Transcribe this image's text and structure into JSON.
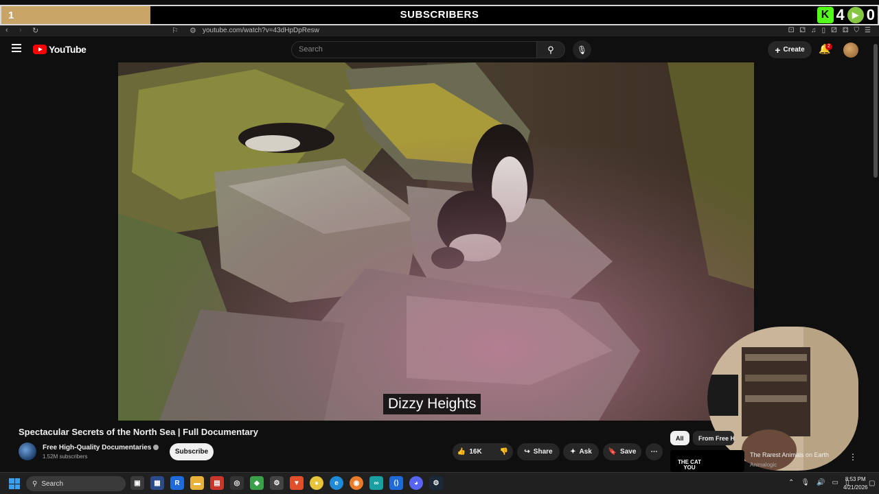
{
  "overlay": {
    "count": "1",
    "label": "SUBSCRIBERS",
    "progress": 0.17,
    "kick_count": "4",
    "rumble_count": "0"
  },
  "browser": {
    "url": "youtube.com/watch?v=43dHpDpResw"
  },
  "header": {
    "logo_text": "YouTube",
    "search_placeholder": "Search",
    "create_label": "Create",
    "notification_count": "2"
  },
  "player": {
    "subtitle": "Dizzy Heights"
  },
  "video": {
    "title": "Spectacular Secrets of the North Sea | Full Documentary",
    "channel_name": "Free High-Quality Documentaries",
    "channel_subs": "1.52M subscribers",
    "subscribe_label": "Subscribe",
    "likes": "16K",
    "share_label": "Share",
    "ask_label": "Ask",
    "save_label": "Save"
  },
  "sidebar": {
    "chips": [
      "All",
      "From Free H"
    ],
    "recommendation": {
      "thumb_text": "THE CAT YOU",
      "title": "The Rarest Animals on Earth",
      "channel": "Animalogic"
    }
  },
  "taskbar": {
    "search_label": "Search",
    "time": "8:53 PM",
    "date": "4/21/2026"
  },
  "colors": {
    "accent": "#ff0000",
    "overlay_progress": "#c8a567",
    "kick_green": "#53fc18"
  }
}
